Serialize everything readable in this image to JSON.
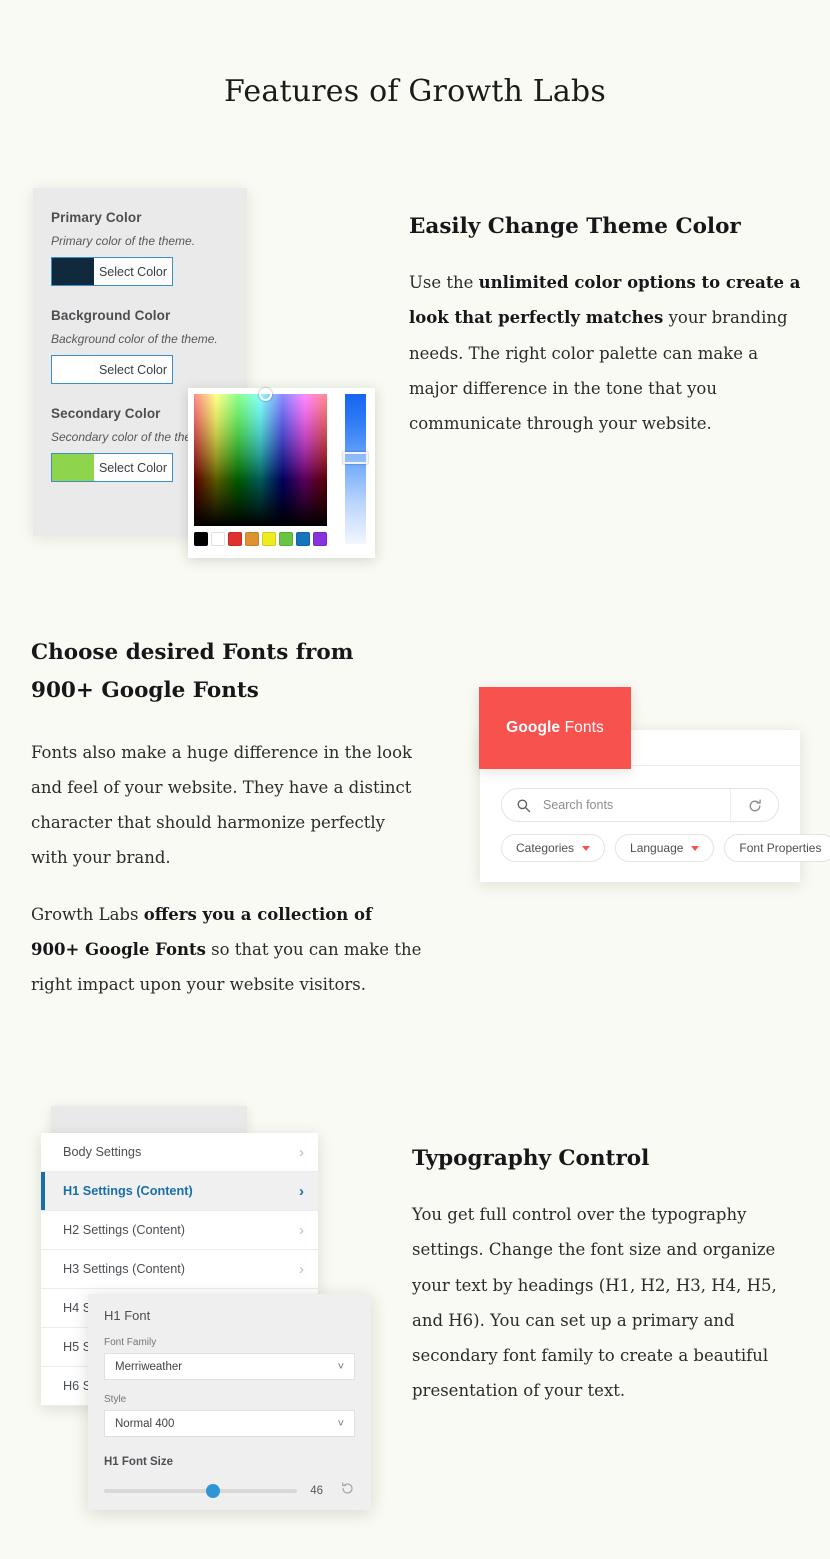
{
  "page": {
    "title": "Features of Growth Labs",
    "background_color": "#f8faf3"
  },
  "features": [
    {
      "heading": "Easily Change Theme Color",
      "paragraph_parts": [
        {
          "text": "Use the ",
          "bold": false
        },
        {
          "text": "unlimited color options to create a look that perfectly matches",
          "bold": true
        },
        {
          "text": " your branding needs. The right color palette can make a major difference in the tone that you communicate through your website.",
          "bold": false
        }
      ],
      "paragraph_plain": "Use the unlimited color options to create a look that perfectly matches your branding needs. The right color palette can make a major difference in the tone that you communicate through your website."
    },
    {
      "heading": "Choose desired Fonts from 900+ Google Fonts",
      "paragraph_1": "Fonts also make a huge difference in the look and feel of your website. They have a distinct character that should harmonize perfectly with your brand.",
      "paragraph_2_parts": [
        {
          "text": "Growth Labs ",
          "bold": false
        },
        {
          "text": "offers you a collection of 900+ Google Fonts",
          "bold": true
        },
        {
          "text": " so that you can make the right impact upon your website visitors.",
          "bold": false
        }
      ]
    },
    {
      "heading": "Typography Control",
      "paragraph": "You get full control over the typography settings. Change the font size and organize your text by headings (H1, H2, H3, H4, H5, and H6). You can set up a primary and secondary font family to create a beautiful presentation of your text."
    }
  ],
  "color_panel": {
    "groups": [
      {
        "label": "Primary Color",
        "description": "Primary color of the theme.",
        "button_label": "Select Color",
        "swatch_color": "#10293c"
      },
      {
        "label": "Background Color",
        "description": "Background color of the theme.",
        "button_label": "Select Color",
        "swatch_color": "#ffffff"
      },
      {
        "label": "Secondary Color",
        "description": "Secondary color of the theme.",
        "button_label": "Select Color",
        "swatch_color": "#8ed44c"
      }
    ],
    "picker": {
      "preset_swatches": [
        "#000000",
        "#ffffff",
        "#e03131",
        "#dd9430",
        "#ecec21",
        "#69c443",
        "#1574bd",
        "#8833dd"
      ],
      "slider_color": "#1565f0"
    }
  },
  "google_fonts_card": {
    "logo_google": "Google",
    "logo_fonts": "Fonts",
    "logo_background": "#f8524f",
    "search_placeholder": "Search fonts",
    "search_value": "",
    "chips": [
      {
        "label": "Categories",
        "has_caret": true
      },
      {
        "label": "Language",
        "has_caret": true
      },
      {
        "label": "Font Properties",
        "has_caret": false
      }
    ]
  },
  "typography_panel": {
    "rows": [
      {
        "label": "Body Settings",
        "active": false
      },
      {
        "label": "H1 Settings (Content)",
        "active": true
      },
      {
        "label": "H2 Settings (Content)",
        "active": false
      },
      {
        "label": "H3 Settings (Content)",
        "active": false
      },
      {
        "label": "H4 Settings (Content)",
        "active": false
      },
      {
        "label": "H5 Settings (Content)",
        "active": false
      },
      {
        "label": "H6 Settings (Content)",
        "active": false
      }
    ],
    "accent_color": "#1a6fa8",
    "popup": {
      "title": "H1 Font",
      "font_family_label": "Font Family",
      "font_family_value": "Merriweather",
      "style_label": "Style",
      "style_value": "Normal 400",
      "font_size_label": "H1 Font Size",
      "font_size_value": "46",
      "slider_percent": 51,
      "slider_color": "#2f95d6"
    }
  }
}
